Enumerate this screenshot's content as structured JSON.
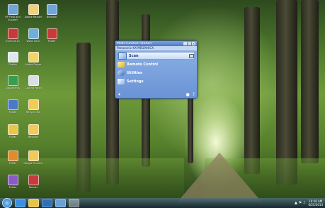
{
  "desktop_icons": [
    {
      "label": "HP Help and Support",
      "color": "#6fa6d8"
    },
    {
      "label": "Adobe Reader",
      "color": "#c73a3a"
    },
    {
      "label": "Network",
      "color": "#dfe6ee"
    },
    {
      "label": "Excel 2010",
      "color": "#3d9b4f"
    },
    {
      "label": "Word 2010",
      "color": "#4b78c8"
    },
    {
      "label": "Google Chrome",
      "color": "#e8c84a"
    },
    {
      "label": "Firefox",
      "color": "#e28b2b"
    },
    {
      "label": "Media Player",
      "color": "#8a5bc6"
    },
    {
      "label": "Documents",
      "color": "#f1d27a"
    },
    {
      "label": "Control Panel",
      "color": "#6fb0d8"
    },
    {
      "label": "Folder",
      "color": "#f3d46a"
    },
    {
      "label": "Recycle Bin",
      "color": "#d9dfe6"
    },
    {
      "label": "Folder",
      "color": "#f1cb5a"
    },
    {
      "label": "Folder",
      "color": "#f1cb5a"
    },
    {
      "label": "Folder",
      "color": "#f1cb5a"
    },
    {
      "label": "Reader",
      "color": "#c63b3b"
    }
  ],
  "window": {
    "title": "Multi-Function Station",
    "model": "Panasonic KX-MB1900CX",
    "items": [
      {
        "label": "Scan",
        "color": "#7aa7e3"
      },
      {
        "label": "Remote Control",
        "color": "#f0d64c"
      },
      {
        "label": "Utilities",
        "color": "#4c79c9"
      },
      {
        "label": "Settings",
        "color": "#8ab2e8"
      }
    ],
    "title_buttons": [
      "_",
      "□",
      "×"
    ],
    "bottom_left_icon_glyph": "✦",
    "bottom_right_icons": [
      "●",
      "?"
    ]
  },
  "taskbar": {
    "apps": [
      {
        "name": "internet-explorer",
        "color": "#3b8fe0"
      },
      {
        "name": "file-explorer",
        "color": "#e8c24a"
      },
      {
        "name": "media-player",
        "color": "#2f6fb8"
      },
      {
        "name": "windows-explorer",
        "color": "#6aa0d8"
      },
      {
        "name": "multi-function-station",
        "color": "#9cc0f0",
        "active": true
      }
    ],
    "tray_glyphs": [
      "▲",
      "⚑",
      "♪"
    ],
    "time": "10:56 AM",
    "date": "6/25/2013"
  }
}
